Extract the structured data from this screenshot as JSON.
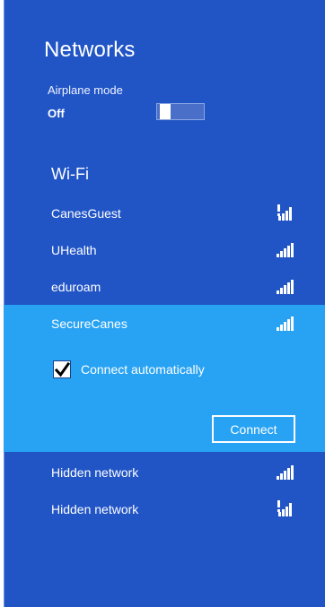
{
  "header": {
    "title": "Networks"
  },
  "airplane_mode": {
    "label": "Airplane mode",
    "state": "Off"
  },
  "wifi": {
    "heading": "Wi-Fi",
    "networks": [
      {
        "name": "CanesGuest",
        "signal_icon": "wifi-signal-secured-warning-icon"
      },
      {
        "name": "UHealth",
        "signal_icon": "wifi-signal-icon"
      },
      {
        "name": "eduroam",
        "signal_icon": "wifi-signal-icon"
      },
      {
        "name": "SecureCanes",
        "signal_icon": "wifi-signal-icon",
        "selected": true
      },
      {
        "name": "Hidden network",
        "signal_icon": "wifi-signal-icon"
      },
      {
        "name": "Hidden network",
        "signal_icon": "wifi-signal-secured-warning-icon"
      }
    ]
  },
  "selected": {
    "connect_automatically_label": "Connect automatically",
    "connect_automatically_checked": true,
    "connect_button_label": "Connect"
  },
  "colors": {
    "panel_bg": "#2155c6",
    "selected_bg": "#28a3f3",
    "text": "#ffffff"
  }
}
